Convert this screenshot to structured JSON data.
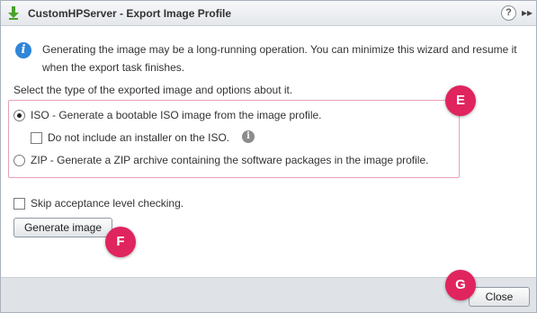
{
  "window": {
    "title": "CustomHPServer - Export Image Profile",
    "help_label": "?",
    "more_label": "▸▸"
  },
  "info": {
    "icon": "info-icon",
    "text": "Generating the image may be a long-running operation. You can minimize this wizard and resume it when the export task finishes."
  },
  "options": {
    "select_label": "Select the type of the exported image and options about it.",
    "iso": {
      "label": "ISO - Generate a bootable ISO image from the image profile.",
      "checked": true
    },
    "no_installer": {
      "label": "Do not include an installer on the ISO.",
      "checked": false
    },
    "zip": {
      "label": "ZIP - Generate a ZIP archive containing the software packages in the image profile.",
      "checked": false
    }
  },
  "skip_acceptance": {
    "label": "Skip acceptance level checking.",
    "checked": false
  },
  "buttons": {
    "generate": "Generate image",
    "close": "Close"
  },
  "markers": {
    "e": "E",
    "f": "F",
    "g": "G"
  },
  "colors": {
    "info_blue": "#2f86d8",
    "marker_pink": "#e0245e",
    "highlight_border": "#e8a1b6",
    "footer_bg": "#dfe3e8",
    "export_arrow_green": "#4aa22a"
  }
}
